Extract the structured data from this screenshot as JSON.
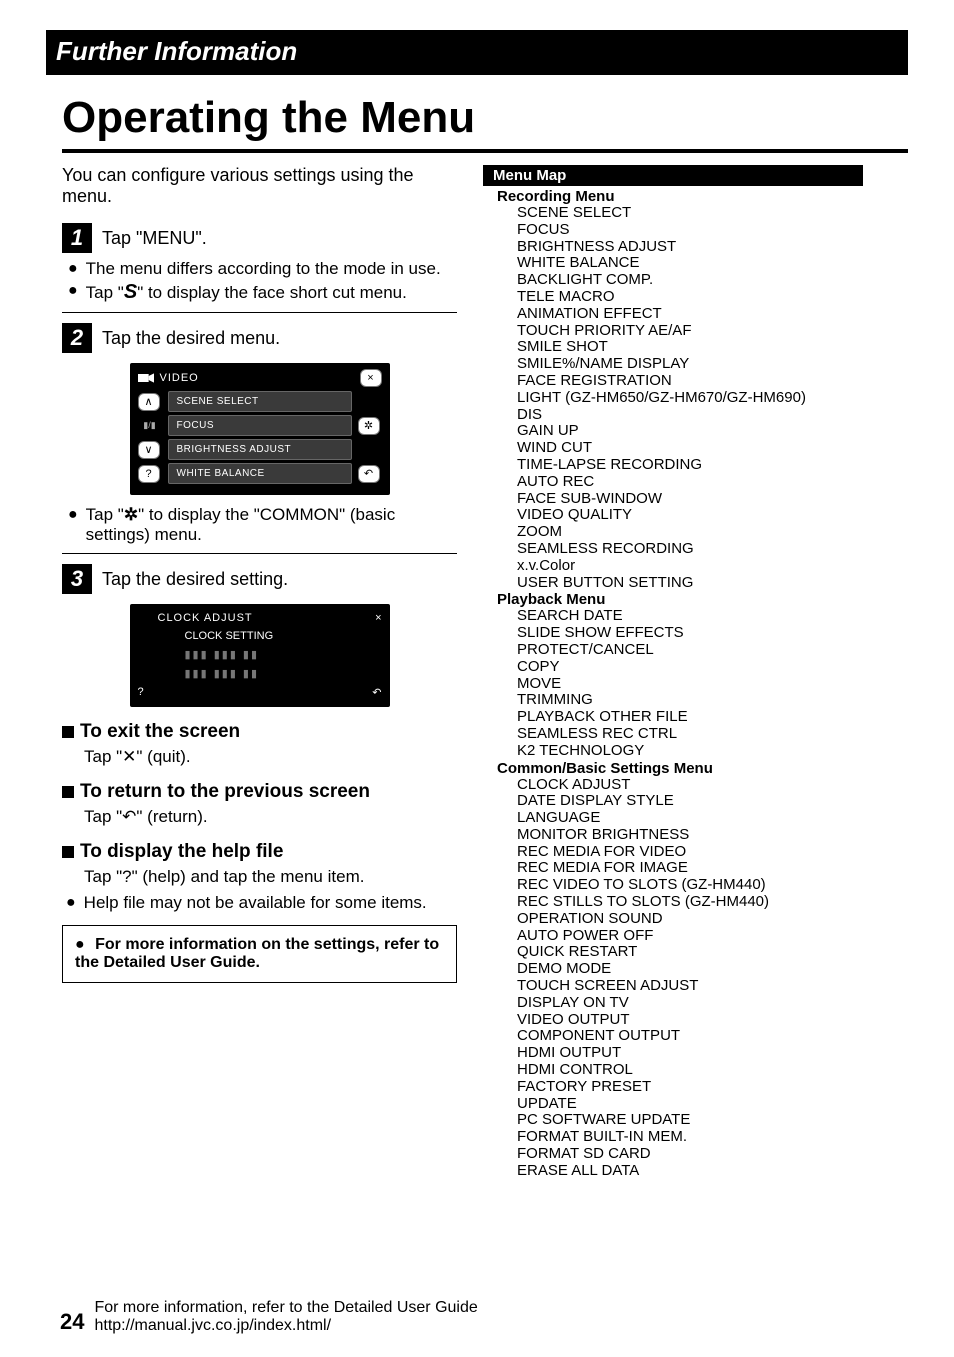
{
  "section_bar": "Further Information",
  "title": "Operating the Menu",
  "intro": "You can configure various settings using the menu.",
  "steps": {
    "s1": {
      "num": "1",
      "text": "Tap \"MENU\"."
    },
    "s1_b1": "The menu differs according to the mode in use.",
    "s1_b2_a": "Tap \"",
    "s1_b2_b": "\" to display the face short cut menu.",
    "s2": {
      "num": "2",
      "text": "Tap the desired menu."
    },
    "s2_b1_a": "Tap \"",
    "s2_b1_b": "\" to display the \"COMMON\" (basic settings) menu.",
    "s3": {
      "num": "3",
      "text": "Tap the desired setting."
    }
  },
  "mock1": {
    "title": "VIDEO",
    "items": [
      "SCENE SELECT",
      "FOCUS",
      "BRIGHTNESS ADJUST",
      "WHITE BALANCE"
    ],
    "close": "×",
    "gear": "✲",
    "back": "↶",
    "help": "?",
    "up": "∧",
    "dn": "∨",
    "pp": "▮/▮"
  },
  "mock2": {
    "title": "CLOCK ADJUST",
    "item1": "CLOCK SETTING",
    "fake": "▮▮▮ ▮▮▮ ▮▮",
    "close": "×",
    "back": "↶",
    "help": "?"
  },
  "exit": {
    "h": "To exit the screen",
    "t": "Tap \"✕\" (quit)."
  },
  "ret": {
    "h": "To return to the previous screen",
    "t": "Tap \"↶\" (return)."
  },
  "helpfile": {
    "h": "To display the help file",
    "t": "Tap \"?\" (help) and tap the menu item.",
    "b": "Help file may not be available for some items."
  },
  "notebox": "For more information on the settings, refer to the Detailed User Guide.",
  "menumap": {
    "title": "Menu Map",
    "rec_h": "Recording Menu",
    "rec": [
      "SCENE SELECT",
      "FOCUS",
      "BRIGHTNESS ADJUST",
      "WHITE BALANCE",
      "BACKLIGHT COMP.",
      "TELE MACRO",
      "ANIMATION EFFECT",
      "TOUCH PRIORITY AE/AF",
      "SMILE SHOT",
      "SMILE%/NAME DISPLAY",
      "FACE REGISTRATION",
      "LIGHT (GZ-HM650/GZ-HM670/GZ-HM690)",
      "DIS",
      "GAIN UP",
      "WIND CUT",
      "TIME-LAPSE RECORDING",
      "AUTO REC",
      "FACE SUB-WINDOW",
      "VIDEO QUALITY",
      "ZOOM",
      "SEAMLESS RECORDING",
      "x.v.Color",
      "USER BUTTON SETTING"
    ],
    "pb_h": "Playback Menu",
    "pb": [
      "SEARCH DATE",
      "SLIDE SHOW EFFECTS",
      "PROTECT/CANCEL",
      "COPY",
      "MOVE",
      "TRIMMING",
      "PLAYBACK OTHER FILE",
      "SEAMLESS REC CTRL",
      "K2 TECHNOLOGY"
    ],
    "cm_h": "Common/Basic Settings Menu",
    "cm": [
      "CLOCK ADJUST",
      "DATE DISPLAY STYLE",
      "LANGUAGE",
      "MONITOR BRIGHTNESS",
      "REC MEDIA FOR VIDEO",
      "REC MEDIA FOR IMAGE",
      "REC VIDEO TO SLOTS (GZ-HM440)",
      "REC STILLS TO SLOTS (GZ-HM440)",
      "OPERATION SOUND",
      "AUTO POWER OFF",
      "QUICK RESTART",
      "DEMO MODE",
      "TOUCH SCREEN ADJUST",
      "DISPLAY ON TV",
      "VIDEO OUTPUT",
      "COMPONENT OUTPUT",
      "HDMI OUTPUT",
      "HDMI CONTROL",
      "FACTORY PRESET",
      "UPDATE",
      "PC SOFTWARE UPDATE",
      "FORMAT BUILT-IN MEM.",
      "FORMAT SD CARD",
      "ERASE ALL DATA"
    ]
  },
  "footer": {
    "page": "24",
    "line1": "For more information, refer to the Detailed User Guide",
    "line2": "http://manual.jvc.co.jp/index.html/"
  }
}
